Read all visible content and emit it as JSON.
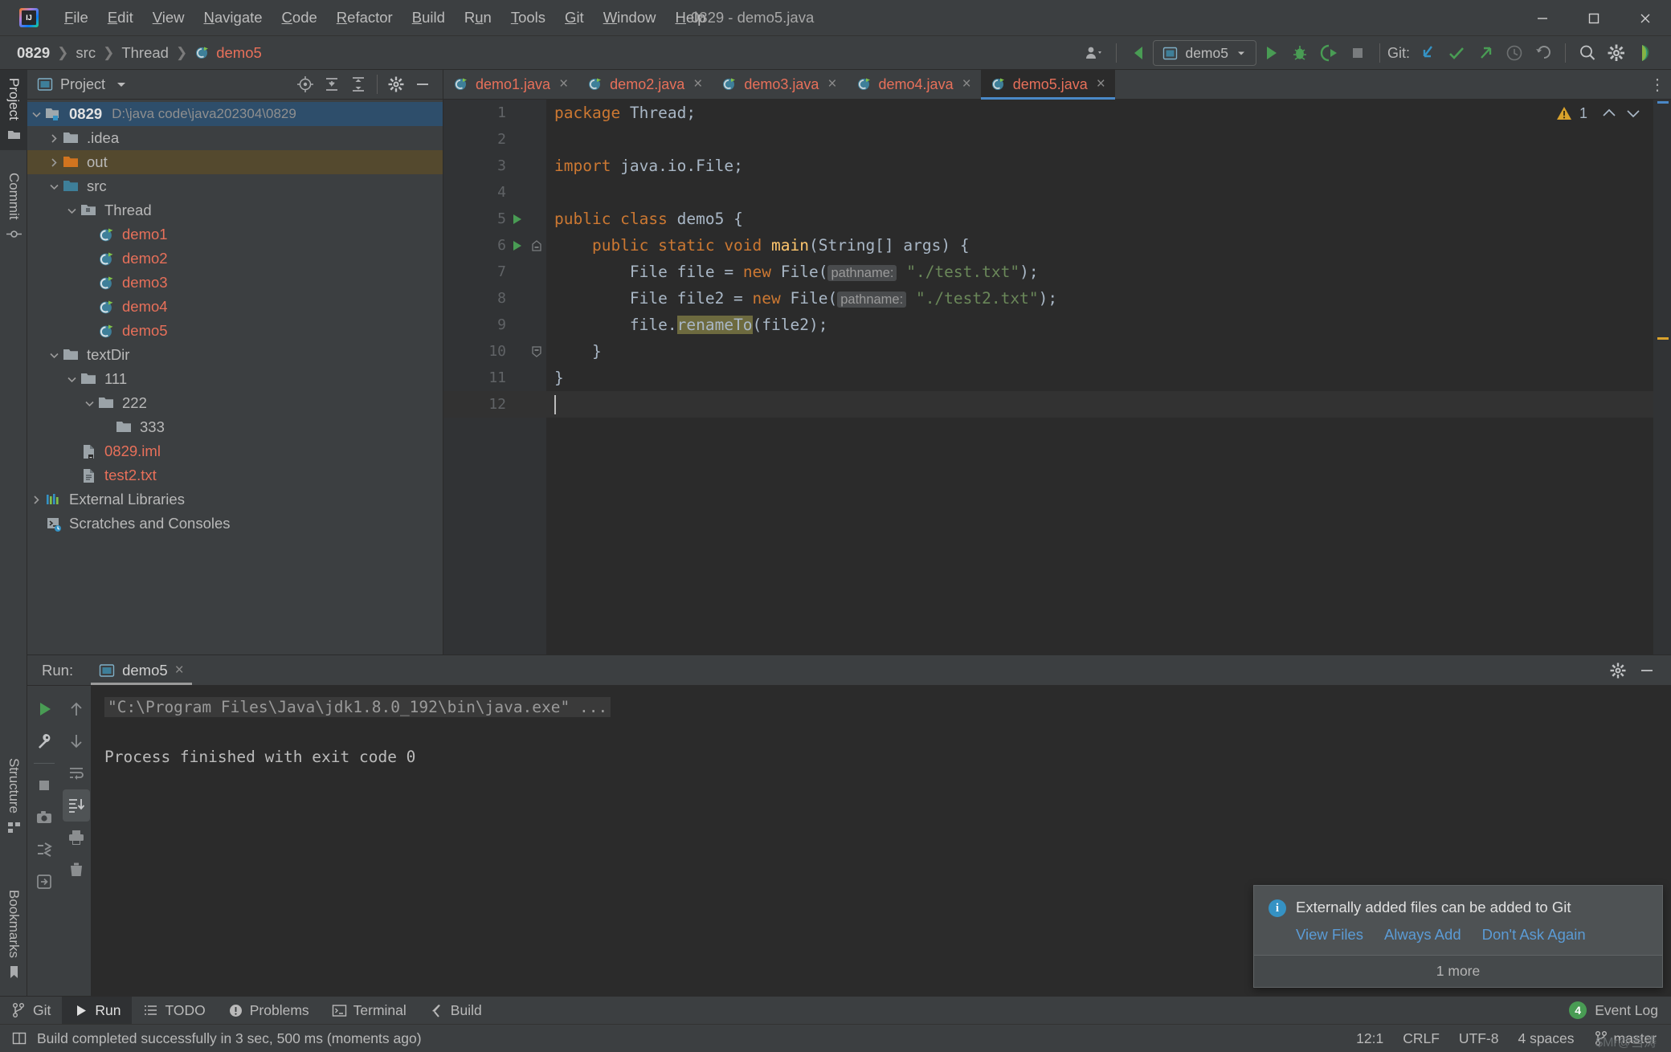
{
  "window": {
    "title": "0829 - demo5.java",
    "menus": [
      {
        "label": "File",
        "mnemonic": "F"
      },
      {
        "label": "Edit",
        "mnemonic": "E"
      },
      {
        "label": "View",
        "mnemonic": "V"
      },
      {
        "label": "Navigate",
        "mnemonic": "N"
      },
      {
        "label": "Code",
        "mnemonic": "C"
      },
      {
        "label": "Refactor",
        "mnemonic": "R"
      },
      {
        "label": "Build",
        "mnemonic": "B"
      },
      {
        "label": "Run",
        "mnemonic": "u"
      },
      {
        "label": "Tools",
        "mnemonic": "T"
      },
      {
        "label": "Git",
        "mnemonic": "G"
      },
      {
        "label": "Window",
        "mnemonic": "W"
      },
      {
        "label": "Help",
        "mnemonic": "H"
      }
    ],
    "controls": {
      "minimize": "minimize-button",
      "maximize": "maximize-button",
      "close": "close-button"
    }
  },
  "navbar": {
    "breadcrumbs": [
      "0829",
      "src",
      "Thread",
      "demo5"
    ],
    "separator": "❯",
    "run_config": "demo5",
    "git_label": "Git:",
    "toolbar_icons": [
      "user-settings-icon",
      "update-project-icon",
      "run-config-selector",
      "run-icon",
      "debug-icon",
      "run-with-coverage-icon",
      "stop-icon",
      "git-update-icon",
      "git-commit-icon",
      "git-push-icon",
      "git-history-icon",
      "git-rollback-icon",
      "search-everywhere-icon",
      "settings-gear-icon",
      "ide-profile-icon"
    ]
  },
  "stripe": {
    "left_top": [
      {
        "label": "Project",
        "icon": "project-folder-icon",
        "active": true
      },
      {
        "label": "Commit",
        "icon": "commit-icon",
        "active": false
      }
    ],
    "left_bottom": [
      {
        "label": "Structure",
        "icon": "structure-icon",
        "active": false
      },
      {
        "label": "Bookmarks",
        "icon": "bookmark-icon",
        "active": false
      }
    ]
  },
  "project_panel": {
    "title": "Project",
    "header_icons": [
      "select-opened-file-icon",
      "expand-all-icon",
      "collapse-all-icon",
      "settings-gear-icon",
      "hide-icon"
    ],
    "tree": [
      {
        "depth": 0,
        "label": "0829",
        "path": "D:\\java code\\java202304\\0829",
        "icon": "module-folder-icon",
        "arrow": "down",
        "bold": true,
        "state": "selected-root"
      },
      {
        "depth": 1,
        "label": ".idea",
        "icon": "folder-icon",
        "arrow": "right"
      },
      {
        "depth": 1,
        "label": "out",
        "icon": "folder-excluded-icon",
        "arrow": "right",
        "state": "highlighted"
      },
      {
        "depth": 1,
        "label": "src",
        "icon": "source-folder-icon",
        "arrow": "down"
      },
      {
        "depth": 2,
        "label": "Thread",
        "icon": "package-folder-icon",
        "arrow": "down"
      },
      {
        "depth": 3,
        "label": "demo1",
        "icon": "java-class-runnable-icon",
        "color": "red"
      },
      {
        "depth": 3,
        "label": "demo2",
        "icon": "java-class-runnable-icon",
        "color": "red"
      },
      {
        "depth": 3,
        "label": "demo3",
        "icon": "java-class-runnable-icon",
        "color": "red"
      },
      {
        "depth": 3,
        "label": "demo4",
        "icon": "java-class-runnable-icon",
        "color": "red"
      },
      {
        "depth": 3,
        "label": "demo5",
        "icon": "java-class-runnable-icon",
        "color": "red"
      },
      {
        "depth": 1,
        "label": "textDir",
        "icon": "folder-icon",
        "arrow": "down"
      },
      {
        "depth": 2,
        "label": "111",
        "icon": "folder-icon",
        "arrow": "down"
      },
      {
        "depth": 3,
        "label": "222",
        "icon": "folder-icon",
        "arrow": "down"
      },
      {
        "depth": 4,
        "label": "333",
        "icon": "folder-icon"
      },
      {
        "depth": 2,
        "label": "0829.iml",
        "icon": "iml-file-icon",
        "color": "red"
      },
      {
        "depth": 2,
        "label": "test2.txt",
        "icon": "text-file-icon",
        "color": "red"
      },
      {
        "depth": 0,
        "label": "External Libraries",
        "icon": "libraries-icon",
        "arrow": "right"
      },
      {
        "depth": 0,
        "label": "Scratches and Consoles",
        "icon": "scratches-icon"
      }
    ]
  },
  "editor": {
    "tabs": [
      {
        "label": "demo1.java",
        "active": false
      },
      {
        "label": "demo2.java",
        "active": false
      },
      {
        "label": "demo3.java",
        "active": false
      },
      {
        "label": "demo4.java",
        "active": false
      },
      {
        "label": "demo5.java",
        "active": true
      }
    ],
    "warning_count": "1",
    "lines": [
      {
        "n": "1",
        "tokens": [
          {
            "t": "package ",
            "c": "kw"
          },
          {
            "t": "Thread;",
            "c": "id"
          }
        ],
        "indent": 0
      },
      {
        "n": "2",
        "tokens": [],
        "indent": 0
      },
      {
        "n": "3",
        "tokens": [
          {
            "t": "import ",
            "c": "kw"
          },
          {
            "t": "java.io.File;",
            "c": "id"
          }
        ],
        "indent": 0
      },
      {
        "n": "4",
        "tokens": [],
        "indent": 0
      },
      {
        "n": "5",
        "tokens": [
          {
            "t": "public class ",
            "c": "kw"
          },
          {
            "t": "demo5 {",
            "c": "id"
          }
        ],
        "indent": 0,
        "runmark": true
      },
      {
        "n": "6",
        "tokens": [
          {
            "t": "    public static void ",
            "c": "kw"
          },
          {
            "t": "main",
            "c": "mth"
          },
          {
            "t": "(String[] args) {",
            "c": "id"
          }
        ],
        "indent": 0,
        "runmark": true,
        "foldmark": "open"
      },
      {
        "n": "7",
        "tokens": [
          {
            "t": "        File file = ",
            "c": "id"
          },
          {
            "t": "new ",
            "c": "kw"
          },
          {
            "t": "File(",
            "c": "id"
          },
          {
            "t": "pathname:",
            "c": "hint"
          },
          {
            "t": " ",
            "c": "id"
          },
          {
            "t": "\"./test.txt\"",
            "c": "str"
          },
          {
            "t": ");",
            "c": "id"
          }
        ],
        "indent": 1
      },
      {
        "n": "8",
        "tokens": [
          {
            "t": "        File file2 = ",
            "c": "id"
          },
          {
            "t": "new ",
            "c": "kw"
          },
          {
            "t": "File(",
            "c": "id"
          },
          {
            "t": "pathname:",
            "c": "hint"
          },
          {
            "t": " ",
            "c": "id"
          },
          {
            "t": "\"./test2.txt\"",
            "c": "str"
          },
          {
            "t": ");",
            "c": "id"
          }
        ],
        "indent": 1
      },
      {
        "n": "9",
        "tokens": [
          {
            "t": "        file.",
            "c": "id"
          },
          {
            "t": "renameTo",
            "c": "idhl"
          },
          {
            "t": "(file2);",
            "c": "id"
          }
        ],
        "indent": 1
      },
      {
        "n": "10",
        "tokens": [
          {
            "t": "    }",
            "c": "id"
          }
        ],
        "indent": 0,
        "foldmark": "close"
      },
      {
        "n": "11",
        "tokens": [
          {
            "t": "}",
            "c": "id"
          }
        ],
        "indent": 0
      },
      {
        "n": "12",
        "tokens": [],
        "indent": 0,
        "caret": true,
        "cursorline": true
      }
    ]
  },
  "run_panel": {
    "label": "Run:",
    "tab": "demo5",
    "command_line": "\"C:\\Program Files\\Java\\jdk1.8.0_192\\bin\\java.exe\" ...",
    "exit_message": "Process finished with exit code 0",
    "tools_col1": [
      "rerun-icon",
      "edit-config-icon",
      "stop-icon",
      "screenshot-icon",
      "dump-threads-icon",
      "export-icon"
    ],
    "tools_col2": [
      "up-arrow-icon",
      "down-arrow-icon",
      "soft-wrap-icon",
      "scroll-to-end-icon",
      "print-icon",
      "clear-all-icon"
    ],
    "header_icons": [
      "settings-gear-icon",
      "hide-icon"
    ]
  },
  "notification": {
    "icon": "info-icon",
    "title": "Externally added files can be added to Git",
    "links": [
      "View Files",
      "Always Add",
      "Don't Ask Again"
    ],
    "more": "1 more"
  },
  "toolwindow_bar": {
    "items": [
      {
        "label": "Git",
        "icon": "git-branch-icon",
        "active": false
      },
      {
        "label": "Run",
        "icon": "run-triangle-icon",
        "active": true
      },
      {
        "label": "TODO",
        "icon": "todo-list-icon",
        "active": false
      },
      {
        "label": "Problems",
        "icon": "problems-icon",
        "active": false
      },
      {
        "label": "Terminal",
        "icon": "terminal-icon",
        "active": false
      },
      {
        "label": "Build",
        "icon": "build-hammer-icon",
        "active": false
      }
    ],
    "event_log": {
      "label": "Event Log",
      "badge": "4"
    }
  },
  "status_bar": {
    "message": "Build completed successfully in 3 sec, 500 ms (moments ago)",
    "message_icon": "book-icon",
    "position": "12:1",
    "line_separator": "CRLF",
    "encoding": "UTF-8",
    "indent": "4 spaces",
    "branch": "master",
    "branch_icon": "git-branch-icon",
    "watermark": "$Mr@当涛"
  },
  "colors": {
    "bg_panel": "#3c3f41",
    "bg_editor": "#2b2b2b",
    "gutter": "#313335",
    "accent_blue": "#4a88c7",
    "text_primary": "#bbbbbb",
    "file_red": "#e8705a",
    "keyword_orange": "#cc7832",
    "string_green": "#6a8759",
    "method_yellow": "#ffc66d",
    "identifier": "#a9b7c6",
    "selection_blue": "#2e4e6b",
    "highlight_brown": "#54492e",
    "link_blue": "#5b9bd5",
    "green_run": "#499c54",
    "warn_yellow": "#d9a22c"
  }
}
